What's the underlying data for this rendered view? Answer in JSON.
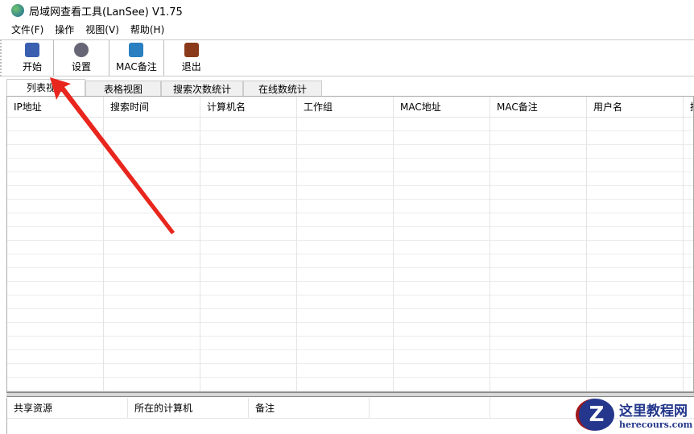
{
  "title": "局域网查看工具(LanSee) V1.75",
  "menu": [
    "文件(F)",
    "操作",
    "视图(V)",
    "帮助(H)"
  ],
  "toolbar": [
    {
      "label": "开始",
      "icon": "start-icon",
      "color": "#3a5fb0"
    },
    {
      "label": "设置",
      "icon": "settings-gear-icon",
      "color": "#556"
    },
    {
      "label": "MAC备注",
      "icon": "mac-note-icon",
      "color": "#2a7fc0"
    },
    {
      "label": "退出",
      "icon": "exit-icon",
      "color": "#8a3a1a"
    }
  ],
  "tabs": [
    "列表视图",
    "表格视图",
    "搜索次数统计",
    "在线数统计"
  ],
  "columns": [
    "IP地址",
    "搜索时间",
    "计算机名",
    "工作组",
    "MAC地址",
    "MAC备注",
    "用户名",
    "搜"
  ],
  "bottom_columns": [
    "共享资源",
    "所在的计算机",
    "备注",
    ""
  ],
  "watermark": {
    "name": "这里教程网",
    "url": "herecours.com"
  }
}
